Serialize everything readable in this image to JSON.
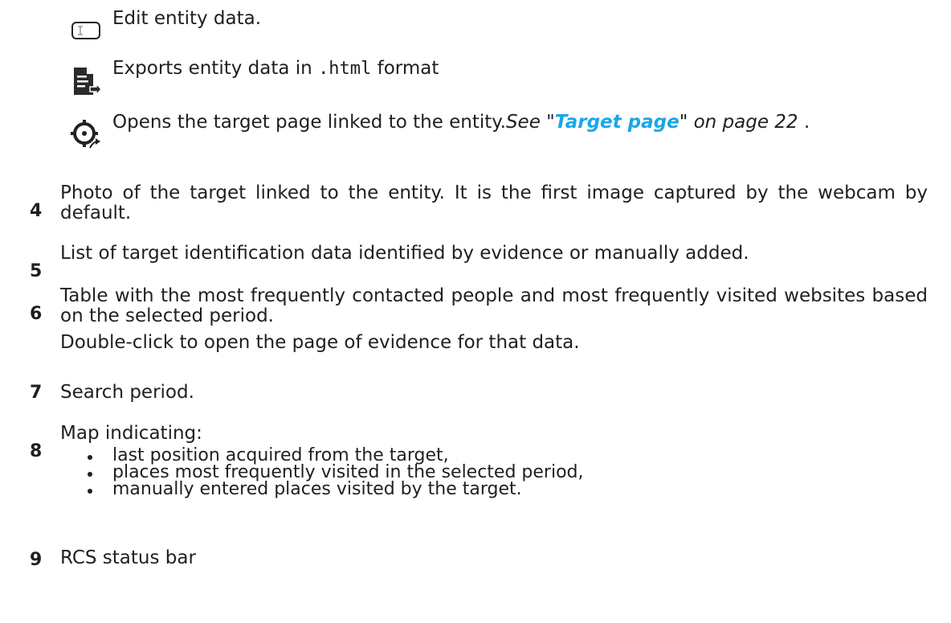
{
  "icons": [
    {
      "icon": "edit-field-icon",
      "text": "Edit entity data."
    },
    {
      "icon": "export-html-icon",
      "text_before": "Exports entity data in ",
      "code": ".html",
      "text_after": " format"
    },
    {
      "icon": "target-page-icon",
      "text": "Opens the target page linked to the entity.",
      "see_prefix": "See \"",
      "link": "Target page",
      "see_suffix": "\" on page 22",
      "end": " ."
    }
  ],
  "items": [
    {
      "num": "4",
      "text": "Photo of the target linked to the entity. It is the first image captured by the webcam by default."
    },
    {
      "num": "5",
      "text": "List of target identification data identified by evidence or manually added."
    },
    {
      "num": "6",
      "text": "Table with the most frequently contacted people and most frequently visited websites based on the selected period.",
      "sub": "Double-click to open the page of evidence for that data."
    },
    {
      "num": "7",
      "text": "Search period."
    },
    {
      "num": "8",
      "text": "Map indicating:",
      "bullets": [
        "last position acquired from the target,",
        "places most frequently visited in the selected period,",
        "manually entered places visited by the target."
      ]
    },
    {
      "num": "9",
      "text": "RCS status bar"
    }
  ]
}
